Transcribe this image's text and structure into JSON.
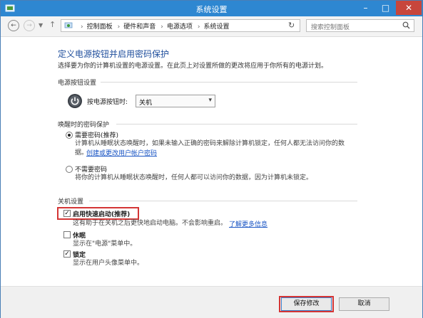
{
  "window": {
    "title": "系统设置",
    "controls": {
      "minimize": "–",
      "maximize": "□",
      "close": "✕"
    }
  },
  "nav": {
    "back_icon": "back-arrow-icon",
    "forward_icon": "forward-arrow-icon",
    "history_icon": "chevron-down-icon",
    "up_icon": "up-arrow-icon"
  },
  "address": {
    "breadcrumbs": [
      "控制面板",
      "硬件和声音",
      "电源选项",
      "系统设置"
    ]
  },
  "search": {
    "placeholder": "搜索控制面板"
  },
  "page": {
    "title": "定义电源按钮并启用密码保护",
    "description": "选择要为你的计算机设置的电源设置。在此页上对设置所做的更改将应用于你所有的电源计划。"
  },
  "power_button_section": {
    "heading": "电源按钮设置",
    "label": "按电源按钮时:",
    "selected": "关机"
  },
  "wake_password_section": {
    "heading": "唤醒时的密码保护",
    "options": [
      {
        "label": "需要密码(推荐)",
        "selected": true,
        "desc_line1": "计算机从睡眠状态唤醒时，如果未输入正确的密码来解除计算机锁定，任何人都无法访问你的数",
        "desc_line2": "据。",
        "link": "创建或更改用户帐户密码"
      },
      {
        "label": "不需要密码",
        "selected": false,
        "desc_line1": "将你的计算机从睡眠状态唤醒时，任何人都可以访问你的数据，因为计算机未锁定。"
      }
    ]
  },
  "shutdown_section": {
    "heading": "关机设置",
    "items": [
      {
        "label": "启用快速启动(推荐)",
        "checked": true,
        "desc": "这有助于在关机之后更快地启动电脑。不会影响重启。",
        "link": "了解更多信息"
      },
      {
        "label": "休眠",
        "checked": false,
        "desc": "显示在\"电源\"菜单中。"
      },
      {
        "label": "锁定",
        "checked": true,
        "desc": "显示在用户头像菜单中。"
      }
    ]
  },
  "footer": {
    "save": "保存修改",
    "cancel": "取消"
  },
  "colors": {
    "titlebar": "#2e87d1",
    "heading": "#1f4e9c",
    "link": "#1a55c4",
    "highlight": "#d43535"
  }
}
